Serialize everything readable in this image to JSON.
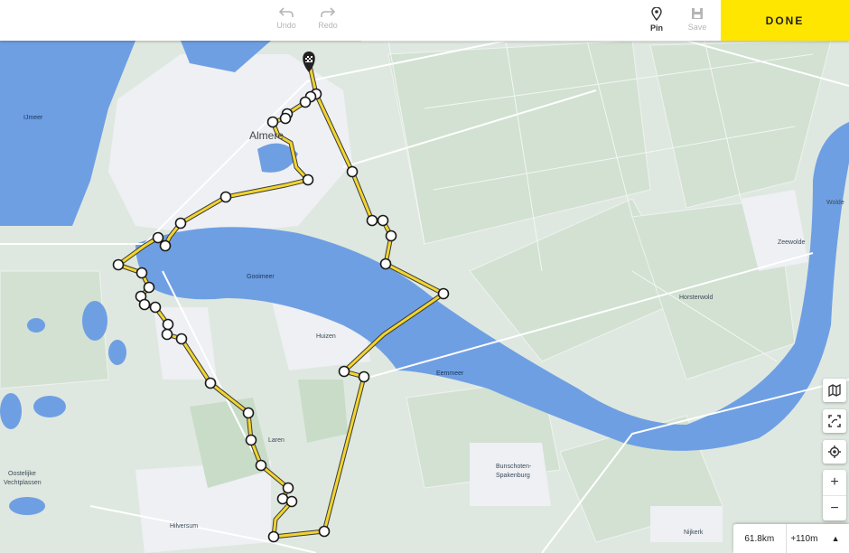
{
  "toolbar": {
    "undo_label": "Undo",
    "redo_label": "Redo",
    "pin_label": "Pin",
    "save_label": "Save",
    "done_label": "DONE"
  },
  "map": {
    "labels": {
      "ijmeer": "IJmeer",
      "almere": "Almere",
      "gooimeer": "Gooimeer",
      "huizen": "Huizen",
      "eemmeer": "Eemmeer",
      "laren": "Laren",
      "bunschoten_1": "Bunschoten-",
      "bunschoten_2": "Spakenburg",
      "hilversum": "Hilversum",
      "oostelijke_1": "Oostelijke",
      "oostelijke_2": "Vechtplassen",
      "zeewolde": "Zeewolde",
      "horsterwold": "Horsterwold",
      "nijkerk": "Nijkerk",
      "wolde": "Wolde"
    },
    "colors": {
      "water": "#6f9fe3",
      "land": "#dfe8e0",
      "route": "#f2d42e",
      "route_outline": "#3a3a3a",
      "accent": "#ffe600"
    }
  },
  "stats": {
    "distance": "61.8km",
    "elevation": "+110m"
  }
}
